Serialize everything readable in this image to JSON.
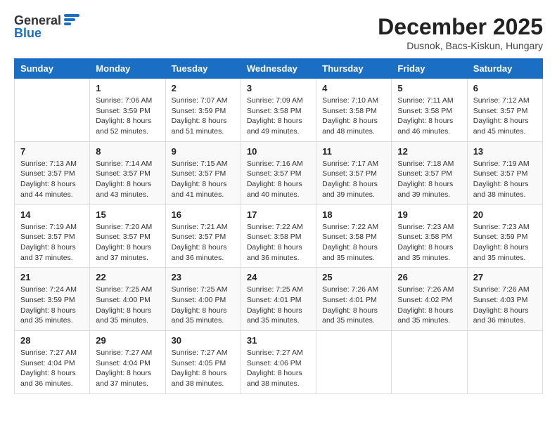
{
  "logo": {
    "general": "General",
    "blue": "Blue"
  },
  "header": {
    "month": "December 2025",
    "location": "Dusnok, Bacs-Kiskun, Hungary"
  },
  "weekdays": [
    "Sunday",
    "Monday",
    "Tuesday",
    "Wednesday",
    "Thursday",
    "Friday",
    "Saturday"
  ],
  "weeks": [
    [
      {
        "day": "",
        "info": ""
      },
      {
        "day": "1",
        "info": "Sunrise: 7:06 AM\nSunset: 3:59 PM\nDaylight: 8 hours\nand 52 minutes."
      },
      {
        "day": "2",
        "info": "Sunrise: 7:07 AM\nSunset: 3:59 PM\nDaylight: 8 hours\nand 51 minutes."
      },
      {
        "day": "3",
        "info": "Sunrise: 7:09 AM\nSunset: 3:58 PM\nDaylight: 8 hours\nand 49 minutes."
      },
      {
        "day": "4",
        "info": "Sunrise: 7:10 AM\nSunset: 3:58 PM\nDaylight: 8 hours\nand 48 minutes."
      },
      {
        "day": "5",
        "info": "Sunrise: 7:11 AM\nSunset: 3:58 PM\nDaylight: 8 hours\nand 46 minutes."
      },
      {
        "day": "6",
        "info": "Sunrise: 7:12 AM\nSunset: 3:57 PM\nDaylight: 8 hours\nand 45 minutes."
      }
    ],
    [
      {
        "day": "7",
        "info": "Sunrise: 7:13 AM\nSunset: 3:57 PM\nDaylight: 8 hours\nand 44 minutes."
      },
      {
        "day": "8",
        "info": "Sunrise: 7:14 AM\nSunset: 3:57 PM\nDaylight: 8 hours\nand 43 minutes."
      },
      {
        "day": "9",
        "info": "Sunrise: 7:15 AM\nSunset: 3:57 PM\nDaylight: 8 hours\nand 41 minutes."
      },
      {
        "day": "10",
        "info": "Sunrise: 7:16 AM\nSunset: 3:57 PM\nDaylight: 8 hours\nand 40 minutes."
      },
      {
        "day": "11",
        "info": "Sunrise: 7:17 AM\nSunset: 3:57 PM\nDaylight: 8 hours\nand 39 minutes."
      },
      {
        "day": "12",
        "info": "Sunrise: 7:18 AM\nSunset: 3:57 PM\nDaylight: 8 hours\nand 39 minutes."
      },
      {
        "day": "13",
        "info": "Sunrise: 7:19 AM\nSunset: 3:57 PM\nDaylight: 8 hours\nand 38 minutes."
      }
    ],
    [
      {
        "day": "14",
        "info": "Sunrise: 7:19 AM\nSunset: 3:57 PM\nDaylight: 8 hours\nand 37 minutes."
      },
      {
        "day": "15",
        "info": "Sunrise: 7:20 AM\nSunset: 3:57 PM\nDaylight: 8 hours\nand 37 minutes."
      },
      {
        "day": "16",
        "info": "Sunrise: 7:21 AM\nSunset: 3:57 PM\nDaylight: 8 hours\nand 36 minutes."
      },
      {
        "day": "17",
        "info": "Sunrise: 7:22 AM\nSunset: 3:58 PM\nDaylight: 8 hours\nand 36 minutes."
      },
      {
        "day": "18",
        "info": "Sunrise: 7:22 AM\nSunset: 3:58 PM\nDaylight: 8 hours\nand 35 minutes."
      },
      {
        "day": "19",
        "info": "Sunrise: 7:23 AM\nSunset: 3:58 PM\nDaylight: 8 hours\nand 35 minutes."
      },
      {
        "day": "20",
        "info": "Sunrise: 7:23 AM\nSunset: 3:59 PM\nDaylight: 8 hours\nand 35 minutes."
      }
    ],
    [
      {
        "day": "21",
        "info": "Sunrise: 7:24 AM\nSunset: 3:59 PM\nDaylight: 8 hours\nand 35 minutes."
      },
      {
        "day": "22",
        "info": "Sunrise: 7:25 AM\nSunset: 4:00 PM\nDaylight: 8 hours\nand 35 minutes."
      },
      {
        "day": "23",
        "info": "Sunrise: 7:25 AM\nSunset: 4:00 PM\nDaylight: 8 hours\nand 35 minutes."
      },
      {
        "day": "24",
        "info": "Sunrise: 7:25 AM\nSunset: 4:01 PM\nDaylight: 8 hours\nand 35 minutes."
      },
      {
        "day": "25",
        "info": "Sunrise: 7:26 AM\nSunset: 4:01 PM\nDaylight: 8 hours\nand 35 minutes."
      },
      {
        "day": "26",
        "info": "Sunrise: 7:26 AM\nSunset: 4:02 PM\nDaylight: 8 hours\nand 35 minutes."
      },
      {
        "day": "27",
        "info": "Sunrise: 7:26 AM\nSunset: 4:03 PM\nDaylight: 8 hours\nand 36 minutes."
      }
    ],
    [
      {
        "day": "28",
        "info": "Sunrise: 7:27 AM\nSunset: 4:04 PM\nDaylight: 8 hours\nand 36 minutes."
      },
      {
        "day": "29",
        "info": "Sunrise: 7:27 AM\nSunset: 4:04 PM\nDaylight: 8 hours\nand 37 minutes."
      },
      {
        "day": "30",
        "info": "Sunrise: 7:27 AM\nSunset: 4:05 PM\nDaylight: 8 hours\nand 38 minutes."
      },
      {
        "day": "31",
        "info": "Sunrise: 7:27 AM\nSunset: 4:06 PM\nDaylight: 8 hours\nand 38 minutes."
      },
      {
        "day": "",
        "info": ""
      },
      {
        "day": "",
        "info": ""
      },
      {
        "day": "",
        "info": ""
      }
    ]
  ]
}
